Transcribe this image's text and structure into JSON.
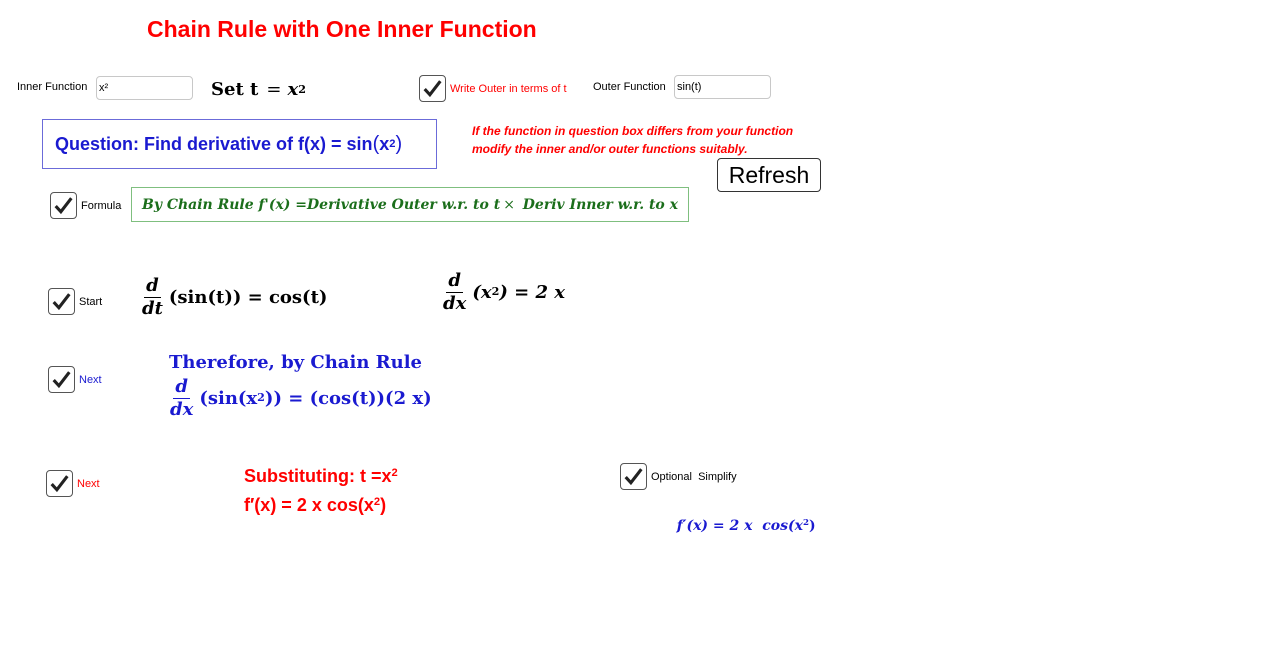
{
  "title": "Chain Rule with One Inner Function",
  "inner": {
    "label": "Inner Function",
    "value": "x²"
  },
  "set_t": {
    "prefix": "Set t",
    "eq": "=",
    "var": "x",
    "exp": "2"
  },
  "write_outer": {
    "label": "Write Outer in terms of t",
    "checked": true
  },
  "outer": {
    "label": "Outer Function",
    "value": "sin(t)"
  },
  "question": {
    "prefix": "Question: Find derivative of f(x) = ",
    "fn": "sin",
    "open": "(",
    "var": "x",
    "exp": "2",
    "close": ")"
  },
  "note": {
    "line1": "If the function in question box differs from your function",
    "line2": "modify the inner and/or outer functions suitably."
  },
  "refresh_label": "Refresh",
  "formula": {
    "label": "Formula",
    "text_a": "By Chain Rule f'(x) =Derivative Outer w.r. to t",
    "times": "×",
    "text_b": " Deriv Inner w.r. to x"
  },
  "start": {
    "label": "Start",
    "outer_num": "d",
    "outer_den": "dt",
    "outer_expr": "(sin(t)) = cos(t)",
    "inner_num": "d",
    "inner_den": "dx",
    "inner_open": "(x",
    "inner_exp": "2",
    "inner_close": ") = 2 x"
  },
  "next1": {
    "label": "Next",
    "heading": "Therefore, by Chain Rule",
    "num": "d",
    "den": "dx",
    "expr_a": "(sin(x",
    "exp": "2",
    "expr_b": ")) = (cos(t))(2 x)"
  },
  "next2": {
    "label": "Next",
    "line1_a": "Substituting: t =x",
    "line1_exp": "2",
    "line2_a": "f′(x) = 2 x cos(x",
    "line2_exp": "2",
    "line2_b": ")"
  },
  "simplify": {
    "label": "Optional  Simplify",
    "expr_a": "f′(x) = 2 x  cos(x",
    "exp": "2",
    "expr_b": ")"
  },
  "colors": {
    "title": "#ff0000",
    "question": "#1a1ad0",
    "formula": "#1b6e1b",
    "blue": "#1a1ad0",
    "red": "#ff0000"
  }
}
